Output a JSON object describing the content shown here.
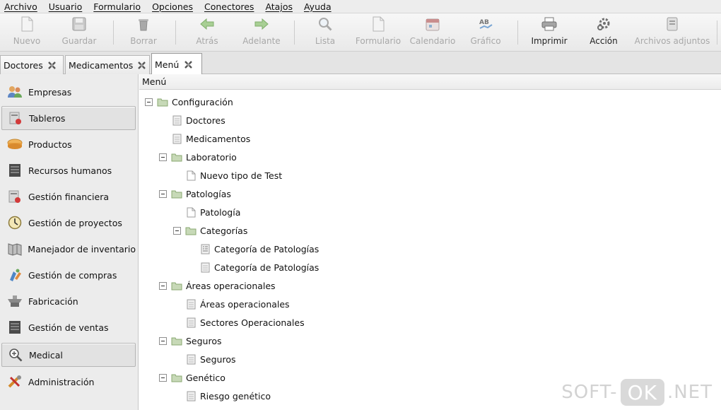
{
  "menubar": [
    "Archivo",
    "Usuario",
    "Formulario",
    "Opciones",
    "Conectores",
    "Atajos",
    "Ayuda"
  ],
  "toolbar": {
    "nuevo": "Nuevo",
    "guardar": "Guardar",
    "borrar": "Borrar",
    "atras": "Atrás",
    "adelante": "Adelante",
    "lista": "Lista",
    "formulario": "Formulario",
    "calendario": "Calendario",
    "grafico": "Gráfico",
    "imprimir": "Imprimir",
    "accion": "Acción",
    "adjuntos": "Archivos adjuntos"
  },
  "tabs": [
    "Doctores",
    "Medicamentos",
    "Menú"
  ],
  "sidebar": [
    "Empresas",
    "Tableros",
    "Productos",
    "Recursos humanos",
    "Gestión financiera",
    "Gestión de proyectos",
    "Manejador de inventario",
    "Gestión de compras",
    "Fabricación",
    "Gestión de ventas",
    "Medical",
    "Administración"
  ],
  "panel": {
    "header": "Menú"
  },
  "tree": [
    "Configuración",
    "Doctores",
    "Medicamentos",
    "Laboratorio",
    "Nuevo tipo de Test",
    "Patologías",
    "Patología",
    "Categorías",
    "Categoría de Patologías",
    "Categoría de Patologías",
    "Áreas operacionales",
    "Áreas operacionales",
    "Sectores Operacionales",
    "Seguros",
    "Seguros",
    "Genético",
    "Riesgo genético"
  ],
  "watermark": {
    "left": "SOFT-",
    "box": "OK",
    "right": ".NET"
  },
  "colors": {
    "folder": "#9fbf86",
    "selected_bg": "#e2e2e2",
    "disabled_text": "#a8a8a8"
  }
}
